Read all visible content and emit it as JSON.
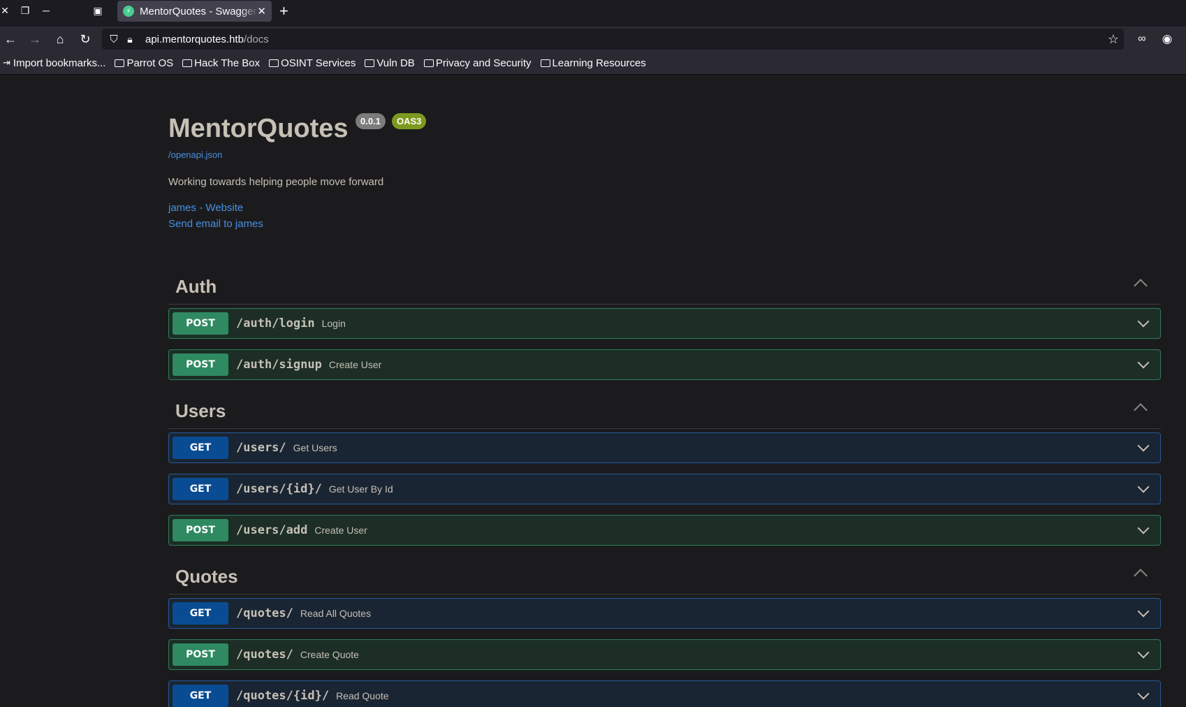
{
  "browser": {
    "tab_title": "MentorQuotes - Swagger UI",
    "url_host": "api.mentorquotes.htb",
    "url_path": "/docs",
    "bookmarks": [
      {
        "label": "Import bookmarks..."
      },
      {
        "label": "Parrot OS"
      },
      {
        "label": "Hack The Box"
      },
      {
        "label": "OSINT Services"
      },
      {
        "label": "Vuln DB"
      },
      {
        "label": "Privacy and Security"
      },
      {
        "label": "Learning Resources"
      }
    ]
  },
  "info": {
    "title": "MentorQuotes",
    "version": "0.0.1",
    "oas": "OAS3",
    "openapi_link": "/openapi.json",
    "description": "Working towards helping people move forward",
    "contact_website": "james - Website",
    "contact_email": "Send email to james"
  },
  "tags": [
    {
      "name": "Auth",
      "operations": [
        {
          "method": "POST",
          "path": "/auth/login",
          "summary": "Login"
        },
        {
          "method": "POST",
          "path": "/auth/signup",
          "summary": "Create User"
        }
      ]
    },
    {
      "name": "Users",
      "operations": [
        {
          "method": "GET",
          "path": "/users/",
          "summary": "Get Users"
        },
        {
          "method": "GET",
          "path": "/users/{id}/",
          "summary": "Get User By Id"
        },
        {
          "method": "POST",
          "path": "/users/add",
          "summary": "Create User"
        }
      ]
    },
    {
      "name": "Quotes",
      "operations": [
        {
          "method": "GET",
          "path": "/quotes/",
          "summary": "Read All Quotes"
        },
        {
          "method": "POST",
          "path": "/quotes/",
          "summary": "Create Quote"
        },
        {
          "method": "GET",
          "path": "/quotes/{id}/",
          "summary": "Read Quote"
        }
      ]
    }
  ]
}
